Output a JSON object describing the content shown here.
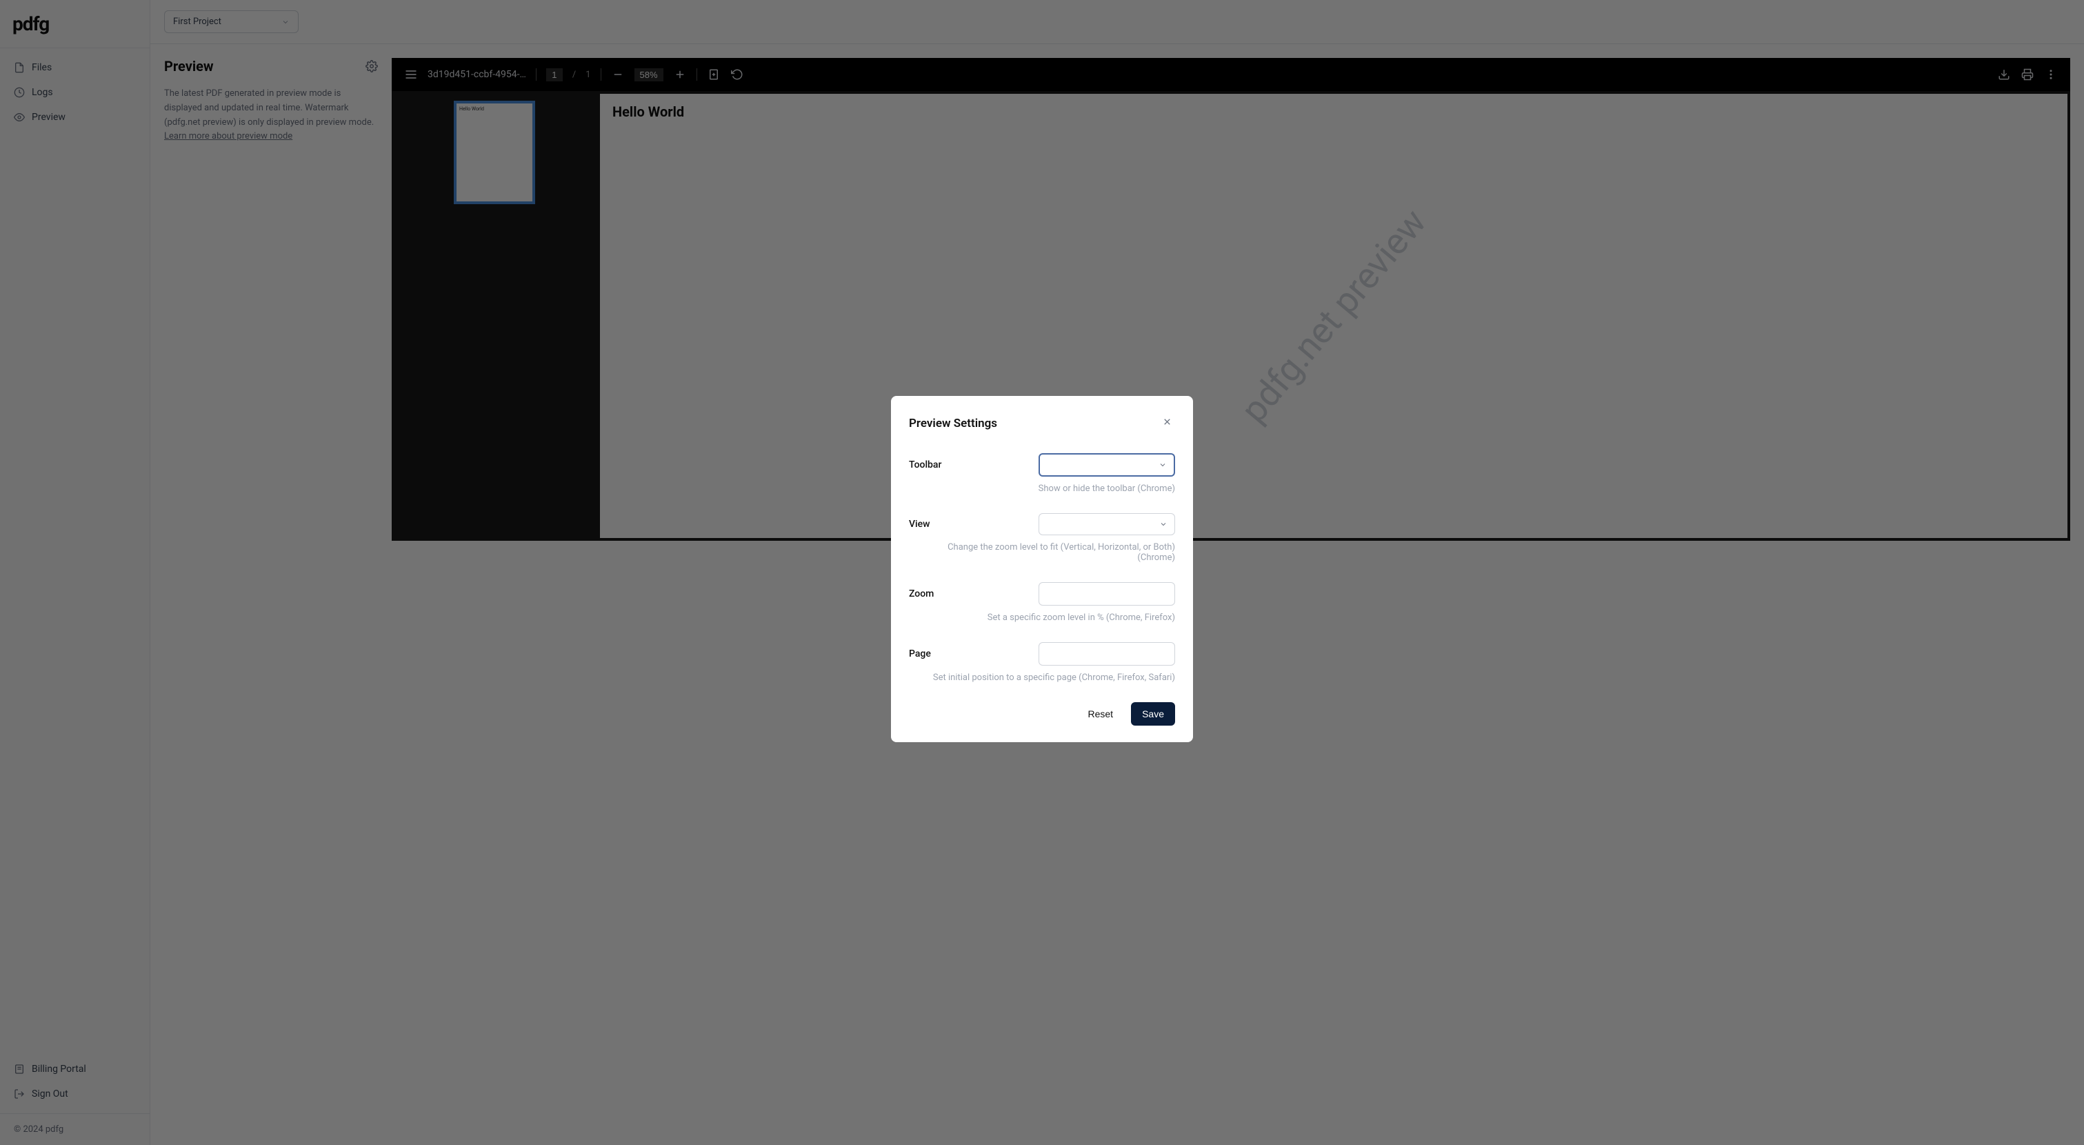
{
  "logo": "pdfg",
  "sidebar": {
    "items": [
      {
        "label": "Files"
      },
      {
        "label": "Logs"
      },
      {
        "label": "Preview"
      }
    ],
    "bottom": [
      {
        "label": "Billing Portal"
      },
      {
        "label": "Sign Out"
      }
    ],
    "copyright": "© 2024 pdfg"
  },
  "topbar": {
    "project": "First Project"
  },
  "preview": {
    "title": "Preview",
    "desc": "The latest PDF generated in preview mode is displayed and updated in real time. Watermark (pdfg.net preview) is only displayed in preview mode.",
    "link": "Learn more about preview mode"
  },
  "viewer": {
    "filename": "3d19d451-ccbf-4954-…",
    "page_current": "1",
    "page_separator": "/",
    "page_total": "1",
    "zoom": "58%",
    "doc_title": "Hello World",
    "thumb_text": "Hello World",
    "watermark": "pdfg.net preview"
  },
  "modal": {
    "title": "Preview Settings",
    "fields": {
      "toolbar": {
        "label": "Toolbar",
        "help": "Show or hide the toolbar (Chrome)"
      },
      "view": {
        "label": "View",
        "help": "Change the zoom level to fit (Vertical, Horizontal, or Both) (Chrome)"
      },
      "zoom": {
        "label": "Zoom",
        "help": "Set a specific zoom level in % (Chrome, Firefox)"
      },
      "page": {
        "label": "Page",
        "help": "Set initial position to a specific page (Chrome, Firefox, Safari)"
      }
    },
    "buttons": {
      "reset": "Reset",
      "save": "Save"
    }
  }
}
